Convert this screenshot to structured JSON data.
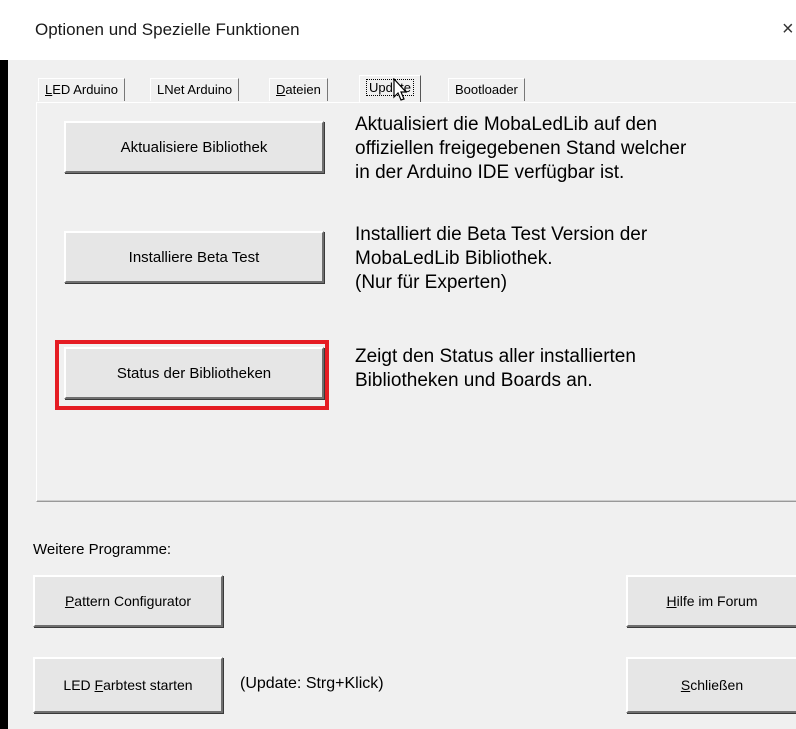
{
  "window": {
    "title": "Optionen und Spezielle Funktionen",
    "close_glyph": "×"
  },
  "tabs": [
    {
      "label": "LED Arduino",
      "access_key": "L",
      "rest": "ED Arduino"
    },
    {
      "label": "LNet Arduino"
    },
    {
      "label": "Dateien",
      "access_key": "D",
      "rest": "ateien"
    },
    {
      "label": "Update",
      "active": true
    },
    {
      "label": "Bootloader"
    }
  ],
  "update_tab": {
    "update_library": {
      "button": "Aktualisiere Bibliothek",
      "description": [
        "Aktualisiert die MobaLedLib auf den",
        "offiziellen freigegebenen Stand welcher",
        "in der Arduino IDE verfügbar ist."
      ]
    },
    "install_beta": {
      "button": "Installiere Beta Test",
      "description": [
        "Installiert die Beta Test Version der",
        "MobaLedLib Bibliothek.",
        "(Nur für Experten)"
      ]
    },
    "library_status": {
      "button": "Status der Bibliotheken",
      "description": [
        "Zeigt den Status aller installierten",
        "Bibliotheken und Boards an."
      ],
      "highlight_color": "#e51c23"
    }
  },
  "footer": {
    "more_programs_label": "Weitere Programme:",
    "pattern_configurator": {
      "access_key": "P",
      "rest": "attern Configurator",
      "label": "Pattern Configurator"
    },
    "help_forum": {
      "access_key": "H",
      "rest": "ilfe im Forum",
      "label": "Hilfe im Forum"
    },
    "led_color_test": {
      "prefix": "LED ",
      "access_key": "F",
      "rest": "arbtest starten",
      "label": "LED Farbtest starten"
    },
    "update_hint": "(Update: Strg+Klick)",
    "close_button": {
      "access_key": "S",
      "rest": "chließen",
      "label": "Schließen"
    }
  },
  "icons": {
    "cursor": "mouse-pointer-icon",
    "close": "close-icon"
  }
}
